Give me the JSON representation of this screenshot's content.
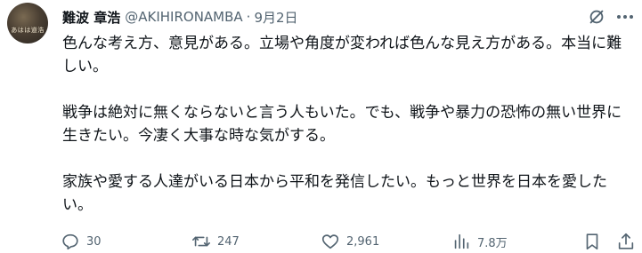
{
  "author": {
    "display_name": "難波 章浩",
    "handle": "@AKIHIRONAMBA",
    "separator": "·",
    "date": "9月2日",
    "avatar_text": "あはは道浩"
  },
  "post": {
    "paragraphs": [
      "色んな考え方、意見がある。立場や角度が変われば色んな見え方がある。本当に難しい。",
      "戦争は絶対に無くならないと言う人もいた。でも、戦争や暴力の恐怖の無い世界に生きたい。今凄く大事な時な気がする。",
      "家族や愛する人達がいる日本から平和を発信したい。もっと世界を日本を愛したい。"
    ]
  },
  "actions": {
    "reply_count": "30",
    "repost_count": "247",
    "like_count": "2,961",
    "views_count": "7.8万"
  },
  "icons": {
    "reply": "reply-icon",
    "repost": "repost-icon",
    "like": "heart-icon",
    "views": "views-icon",
    "bookmark": "bookmark-icon",
    "share": "share-icon",
    "grok": "grok-icon",
    "more": "more-icon"
  },
  "colors": {
    "text": "#0f1419",
    "secondary": "#536471"
  }
}
